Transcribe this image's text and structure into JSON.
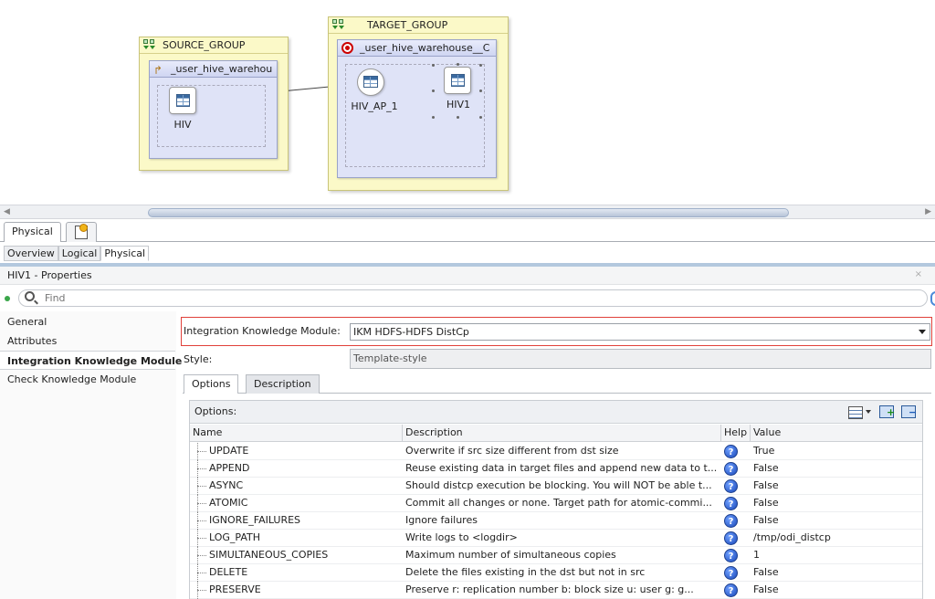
{
  "diagram": {
    "source_group": {
      "title": "SOURCE_GROUP",
      "datastore_title": "_user_hive_warehou",
      "node_label": "HIV"
    },
    "target_group": {
      "title": "TARGET_GROUP",
      "datastore_title": "_user_hive_warehouse__C",
      "ap_node_label": "HIV_AP_1",
      "target_node_label": "HIV1"
    }
  },
  "view_tabs": {
    "physical": "Physical"
  },
  "mini_tabs": [
    "Overview",
    "Logical",
    "Physical"
  ],
  "properties": {
    "title": "HIV1 - Properties",
    "find_placeholder": "Find",
    "nav": [
      "General",
      "Attributes",
      "Integration Knowledge Module",
      "Check Knowledge Module"
    ],
    "ikm_label": "Integration Knowledge Module:",
    "ikm_value": "IKM HDFS-HDFS DistCp",
    "style_label": "Style:",
    "style_value": "Template-style",
    "tabs": [
      "Options",
      "Description"
    ],
    "options_caption": "Options:",
    "columns": [
      "Name",
      "Description",
      "Help",
      "Value"
    ],
    "rows": [
      {
        "name": "UPDATE",
        "description": "Overwrite if src size different from dst size",
        "value": "True"
      },
      {
        "name": "APPEND",
        "description": "Reuse existing data in target files and append new data to t...",
        "value": "False"
      },
      {
        "name": "ASYNC",
        "description": "Should distcp execution be blocking. You will NOT be able t...",
        "value": "False"
      },
      {
        "name": "ATOMIC",
        "description": "Commit all changes or none. Target path for atomic-commi...",
        "value": "False"
      },
      {
        "name": "IGNORE_FAILURES",
        "description": "Ignore failures",
        "value": "False"
      },
      {
        "name": "LOG_PATH",
        "description": "Write logs to <logdir>",
        "value": " /tmp/odi_distcp"
      },
      {
        "name": "SIMULTANEOUS_COPIES",
        "description": "Maximum number of simultaneous copies",
        "value": "1"
      },
      {
        "name": "DELETE",
        "description": "Delete the files existing in the dst but not in src",
        "value": "False"
      },
      {
        "name": "PRESERVE",
        "description": "Preserve   r: replication number   b: block size   u: user   g: g...",
        "value": "False"
      }
    ]
  },
  "colors": {
    "group_fill": "#fbf9c8",
    "datastore_fill": "#dfe3f7",
    "highlight_border": "#e0413a",
    "help_icon": "#1847b8"
  }
}
